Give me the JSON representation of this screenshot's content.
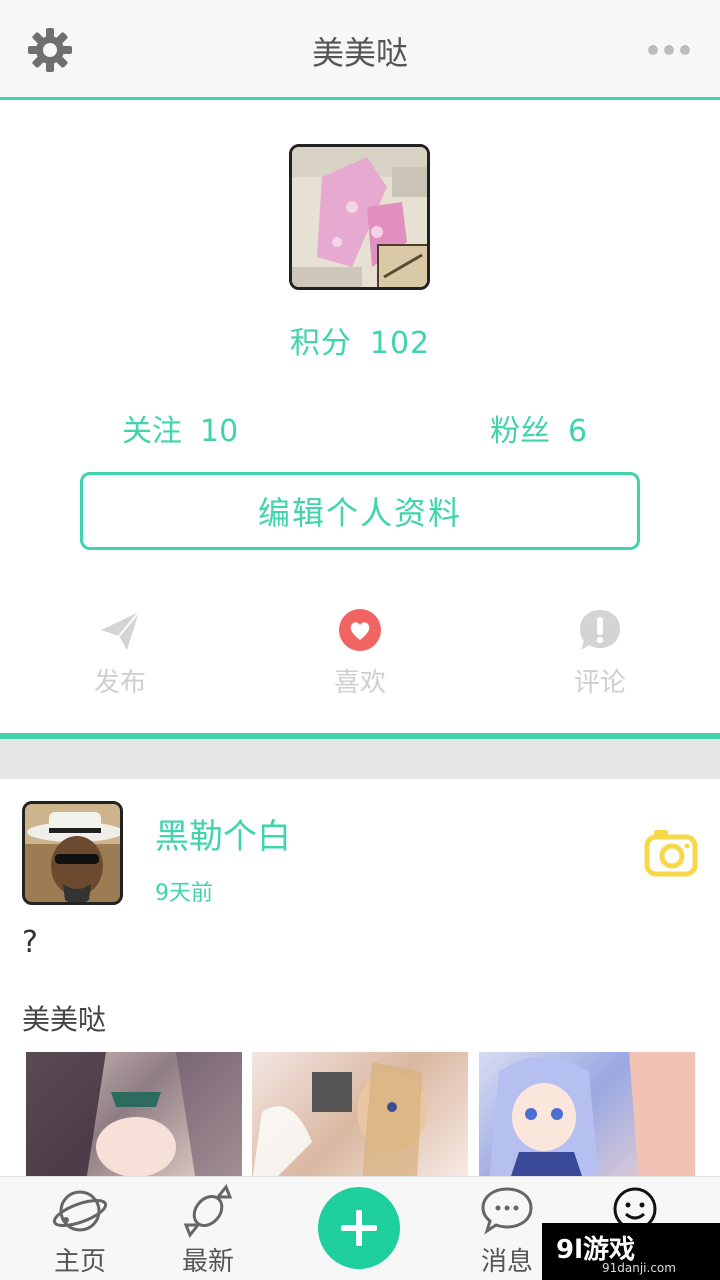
{
  "header": {
    "title": "美美哒",
    "settings_icon": "gear-icon",
    "more_icon": "more-dots-icon"
  },
  "profile": {
    "score_label": "积分",
    "score_value": "102",
    "follow_label": "关注",
    "follow_value": "10",
    "fans_label": "粉丝",
    "fans_value": "6",
    "edit_button": "编辑个人资料"
  },
  "tabs": [
    {
      "label": "发布",
      "icon": "paper-plane-icon",
      "active": false
    },
    {
      "label": "喜欢",
      "icon": "heart-icon",
      "active": true
    },
    {
      "label": "评论",
      "icon": "exclamation-bubble-icon",
      "active": false
    }
  ],
  "post": {
    "author": "黑勒个白",
    "time": "9天前",
    "text": "?",
    "group": "美美哒",
    "camera_icon": "camera-icon"
  },
  "bottom_nav": {
    "home": "主页",
    "latest": "最新",
    "messages": "消息"
  },
  "watermark": {
    "main": "9l游戏",
    "sub": "91danji.com"
  },
  "colors": {
    "accent": "#3fd4ab",
    "heart": "#f26464",
    "camera": "#f7d84a"
  }
}
